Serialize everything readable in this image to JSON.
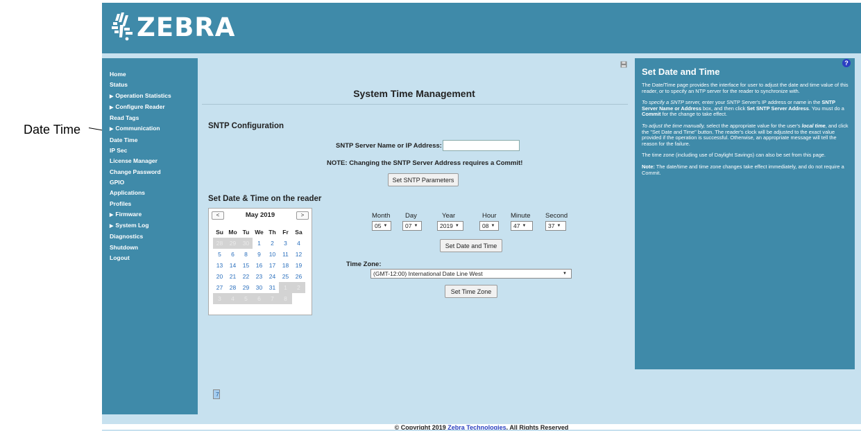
{
  "callout": {
    "label": "Date Time"
  },
  "brand": {
    "name": "ZEBRA"
  },
  "sidebar": {
    "items": [
      {
        "label": "Home",
        "expandable": false
      },
      {
        "label": "Status",
        "expandable": false
      },
      {
        "label": "Operation Statistics",
        "expandable": true
      },
      {
        "label": "Configure Reader",
        "expandable": true
      },
      {
        "label": "Read Tags",
        "expandable": false
      },
      {
        "label": "Communication",
        "expandable": true
      },
      {
        "label": "Date Time",
        "expandable": false
      },
      {
        "label": "IP Sec",
        "expandable": false
      },
      {
        "label": "License Manager",
        "expandable": false
      },
      {
        "label": "Change Password",
        "expandable": false
      },
      {
        "label": "GPIO",
        "expandable": false
      },
      {
        "label": "Applications",
        "expandable": false
      },
      {
        "label": "Profiles",
        "expandable": false
      },
      {
        "label": "Firmware",
        "expandable": true
      },
      {
        "label": "System Log",
        "expandable": true
      },
      {
        "label": "Diagnostics",
        "expandable": false
      },
      {
        "label": "Shutdown",
        "expandable": false
      },
      {
        "label": "Logout",
        "expandable": false
      }
    ]
  },
  "main": {
    "title": "System Time Management",
    "sntp": {
      "section_title": "SNTP Configuration",
      "server_label": "SNTP Server Name or IP Address:",
      "server_value": "",
      "note": "NOTE: Changing the SNTP Server Address requires a Commit!",
      "button": "Set SNTP Parameters"
    },
    "datetime": {
      "section_title": "Set Date & Time on the reader",
      "fields": [
        {
          "label": "Month",
          "value": "05"
        },
        {
          "label": "Day",
          "value": "07"
        },
        {
          "label": "Year",
          "value": "2019"
        },
        {
          "label": "Hour",
          "value": "08"
        },
        {
          "label": "Minute",
          "value": "47"
        },
        {
          "label": "Second",
          "value": "37"
        }
      ],
      "button": "Set Date and Time",
      "timezone_label": "Time Zone:",
      "timezone_value": "(GMT-12:00) International Date Line West",
      "timezone_button": "Set Time Zone"
    },
    "calendar": {
      "month_label": "May 2019",
      "prev": "<",
      "next": ">",
      "dow": [
        "Su",
        "Mo",
        "Tu",
        "We",
        "Th",
        "Fr",
        "Sa"
      ],
      "days": [
        {
          "d": "28",
          "other": true
        },
        {
          "d": "29",
          "other": true
        },
        {
          "d": "30",
          "other": true
        },
        {
          "d": "1"
        },
        {
          "d": "2"
        },
        {
          "d": "3"
        },
        {
          "d": "4"
        },
        {
          "d": "5"
        },
        {
          "d": "6"
        },
        {
          "d": "7",
          "selected": true
        },
        {
          "d": "8"
        },
        {
          "d": "9"
        },
        {
          "d": "10"
        },
        {
          "d": "11"
        },
        {
          "d": "12"
        },
        {
          "d": "13"
        },
        {
          "d": "14"
        },
        {
          "d": "15"
        },
        {
          "d": "16"
        },
        {
          "d": "17"
        },
        {
          "d": "18"
        },
        {
          "d": "19"
        },
        {
          "d": "20"
        },
        {
          "d": "21"
        },
        {
          "d": "22"
        },
        {
          "d": "23"
        },
        {
          "d": "24"
        },
        {
          "d": "25"
        },
        {
          "d": "26"
        },
        {
          "d": "27"
        },
        {
          "d": "28"
        },
        {
          "d": "29"
        },
        {
          "d": "30"
        },
        {
          "d": "31"
        },
        {
          "d": "1",
          "other": true
        },
        {
          "d": "2",
          "other": true
        },
        {
          "d": "3",
          "other": true
        },
        {
          "d": "4",
          "other": true
        },
        {
          "d": "5",
          "other": true
        },
        {
          "d": "6",
          "other": true
        },
        {
          "d": "7",
          "other": true
        },
        {
          "d": "8",
          "other": true
        }
      ]
    }
  },
  "help": {
    "icon": "?",
    "title": "Set Date and Time",
    "p1": "The Date/Time page provides the interface for user to adjust the date and time value of this reader, or to specify an NTP server for the reader to synchronize with.",
    "p2_intro": "To specify a SNTP server,",
    "p2_a": " enter your SNTP Server's IP address or name in the ",
    "p2_b": "SNTP Server Name or Address",
    "p2_c": " box, and then click ",
    "p2_d": "Set SNTP Server Address",
    "p2_e": ". You must do a ",
    "p2_f": "Commit",
    "p2_g": " for the change to take effect.",
    "p3_intro": "To adjust the time manually,",
    "p3_a": " select the appropriate value for the user's ",
    "p3_b": "local time",
    "p3_c": ", and click the \"Set Date and Time\" button. The reader's clock will be adjusted to the exact value provided if the operation is successful. Otherwise, an appropriate message will tell the reason for the failure.",
    "p4": "The time zone (including use of Daylight Savings) can also be set from this page.",
    "p5_b": "Note:",
    "p5_a": " The date/time and time zone changes take effect immediately, and do not require a Commit."
  },
  "footer": {
    "prefix": "© Copyright 2019 ",
    "link": "Zebra Technologies",
    "suffix": ". All Rights Reserved"
  }
}
